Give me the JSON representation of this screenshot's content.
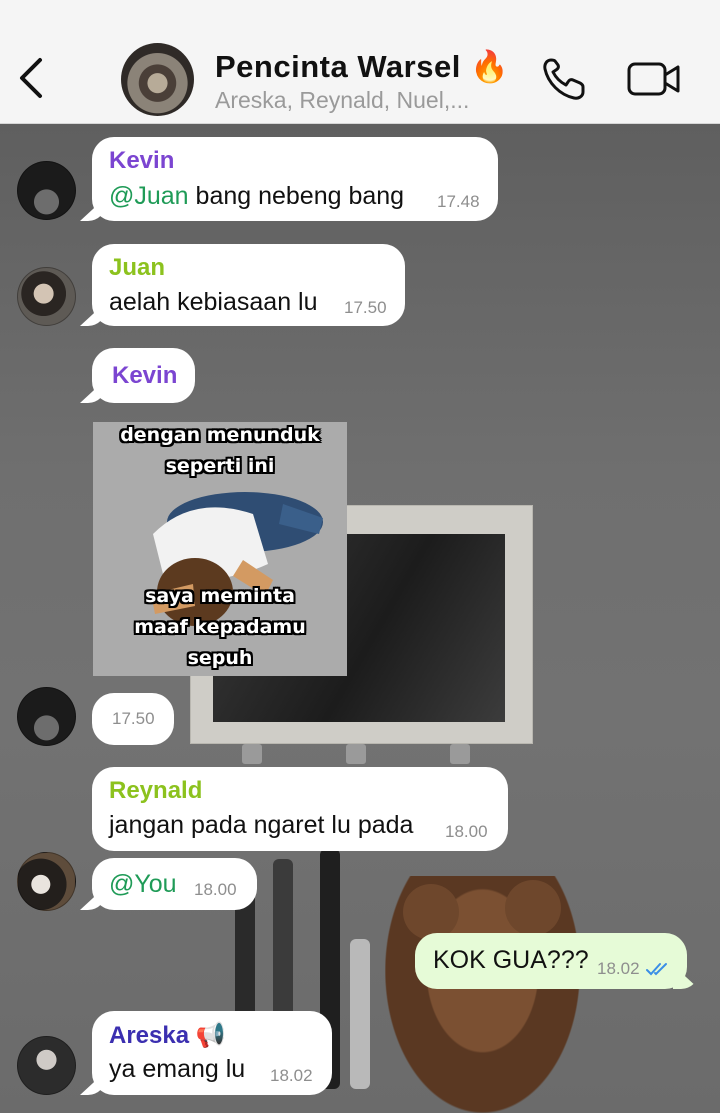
{
  "header": {
    "title": "Pencinta Warsel 🔥",
    "members": "Areska, Reynald, Nuel,..."
  },
  "icons": {
    "back": "chevron-left-icon",
    "call": "phone-icon",
    "video": "video-camera-icon"
  },
  "colors": {
    "kevin": "#7b45d1",
    "juan": "#8cc21e",
    "reynald": "#8cc21e",
    "areska": "#3b2fb0",
    "mention": "#1f9b57",
    "outgoing_bubble": "#e6fbd7",
    "read_ticks": "#3a8ee6"
  },
  "messages": [
    {
      "sender": "Kevin",
      "mention": "@Juan",
      "text": " bang nebeng bang",
      "time": "17.48"
    },
    {
      "sender": "Juan",
      "text": "aelah kebiasaan lu",
      "time": "17.50"
    },
    {
      "sender": "Kevin",
      "image_caption_top": "dengan menunduk\nseperti ini",
      "image_caption_bottom": "saya meminta\nmaaf kepadamu\nsepuh",
      "time": "17.50"
    },
    {
      "sender": "Reynald",
      "text": "jangan pada ngaret lu pada",
      "time": "18.00"
    },
    {
      "mention": "@You",
      "time": "18.00"
    },
    {
      "text": "KOK GUA???",
      "time": "18.02"
    },
    {
      "sender": "Areska 📢",
      "text": "ya emang lu",
      "time": "18.02"
    }
  ]
}
